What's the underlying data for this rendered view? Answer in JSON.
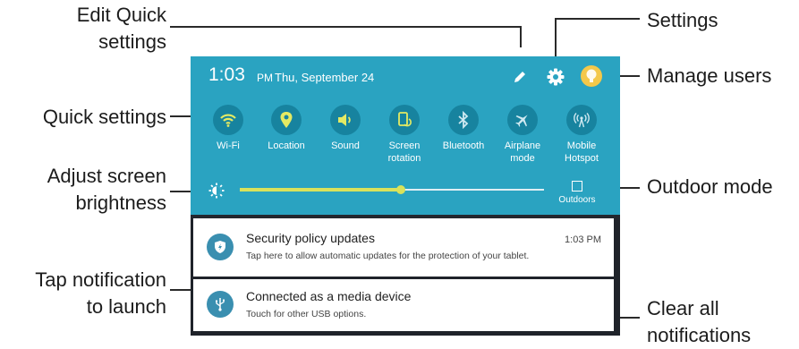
{
  "callouts": {
    "edit_quick_line1": "Edit Quick",
    "edit_quick_line2": "settings",
    "settings": "Settings",
    "manage_users": "Manage users",
    "quick_settings": "Quick settings",
    "adjust_line1": "Adjust screen",
    "adjust_line2": "brightness",
    "outdoor_mode": "Outdoor mode",
    "tap_line1": "Tap notification",
    "tap_line2": "to launch",
    "clear_line1": "Clear all",
    "clear_line2": "notifications"
  },
  "status_bar": {
    "time": "1:03",
    "ampm": "PM",
    "date": "Thu, September 24"
  },
  "quick_settings": [
    {
      "label1": "Wi-Fi",
      "label2": "",
      "icon": "wifi-icon"
    },
    {
      "label1": "Location",
      "label2": "",
      "icon": "location-icon"
    },
    {
      "label1": "Sound",
      "label2": "",
      "icon": "sound-icon"
    },
    {
      "label1": "Screen",
      "label2": "rotation",
      "icon": "screen-rotation-icon"
    },
    {
      "label1": "Bluetooth",
      "label2": "",
      "icon": "bluetooth-icon"
    },
    {
      "label1": "Airplane",
      "label2": "mode",
      "icon": "airplane-icon"
    },
    {
      "label1": "Mobile",
      "label2": "Hotspot",
      "icon": "hotspot-icon"
    }
  ],
  "brightness": {
    "level": 0.53
  },
  "outdoors_label": "Outdoors",
  "notifications": [
    {
      "title": "Security policy updates",
      "subtitle": "Tap here to allow automatic updates for the protection of your tablet.",
      "time": "1:03 PM",
      "icon": "shield-icon"
    },
    {
      "title": "Connected as a media device",
      "subtitle": "Touch for other USB options.",
      "time": "",
      "icon": "usb-icon"
    }
  ],
  "colors": {
    "panel": "#2aa3c1",
    "toggle": "#17839f",
    "accent": "#d9e25b",
    "avatar": "#f3c84a"
  }
}
